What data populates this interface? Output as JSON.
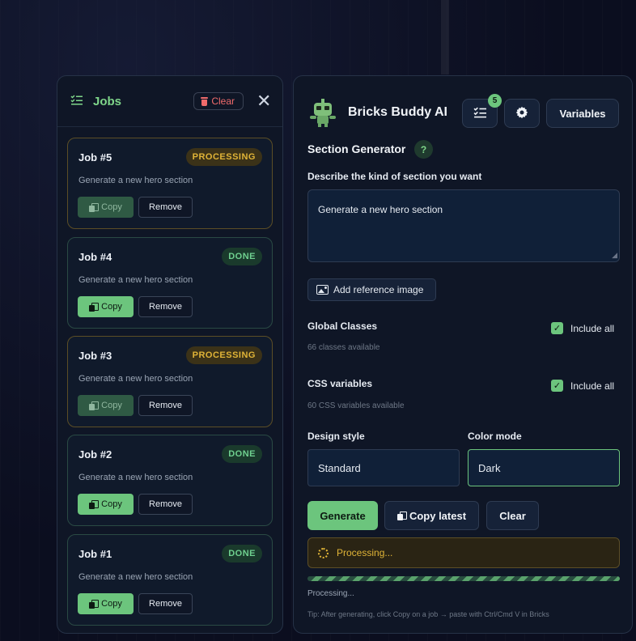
{
  "jobs_panel": {
    "title": "Jobs",
    "clear_label": "Clear",
    "jobs": [
      {
        "title": "Job #5",
        "status": "PROCESSING",
        "description": "Generate a new hero section",
        "copy_label": "Copy",
        "remove_label": "Remove"
      },
      {
        "title": "Job #4",
        "status": "DONE",
        "description": "Generate a new hero section",
        "copy_label": "Copy",
        "remove_label": "Remove"
      },
      {
        "title": "Job #3",
        "status": "PROCESSING",
        "description": "Generate a new hero section",
        "copy_label": "Copy",
        "remove_label": "Remove"
      },
      {
        "title": "Job #2",
        "status": "DONE",
        "description": "Generate a new hero section",
        "copy_label": "Copy",
        "remove_label": "Remove"
      },
      {
        "title": "Job #1",
        "status": "DONE",
        "description": "Generate a new hero section",
        "copy_label": "Copy",
        "remove_label": "Remove"
      }
    ]
  },
  "main": {
    "app_name": "Bricks Buddy AI",
    "jobs_count": "5",
    "variables_label": "Variables",
    "section_title": "Section Generator",
    "help_label": "?",
    "prompt_label": "Describe the kind of section you want",
    "prompt_value": "Generate a new hero section",
    "ref_image_label": "Add reference image",
    "global_classes": {
      "label": "Global Classes",
      "sub": "66 classes available",
      "include_label": "Include all",
      "checked": true
    },
    "css_variables": {
      "label": "CSS variables",
      "sub": "60 CSS variables available",
      "include_label": "Include all",
      "checked": true
    },
    "design_style": {
      "label": "Design style",
      "value": "Standard"
    },
    "color_mode": {
      "label": "Color mode",
      "value": "Dark"
    },
    "generate_label": "Generate",
    "copy_latest_label": "Copy latest",
    "clear_label": "Clear",
    "status_text": "Processing...",
    "progress_text": "Processing...",
    "tip": "Tip: After generating, click Copy on a job → paste with Ctrl/Cmd V in Bricks"
  },
  "colors": {
    "accent": "#6cc57d",
    "processing": "#e0b437",
    "danger": "#f06b6b",
    "panel": "#0f1626",
    "background": "#0b0e1f"
  },
  "icons": [
    "list-check-icon",
    "trash-icon",
    "close-icon",
    "copy-icon",
    "robot-logo-icon",
    "gear-icon",
    "image-icon",
    "checkbox-icon",
    "spinner-icon"
  ]
}
